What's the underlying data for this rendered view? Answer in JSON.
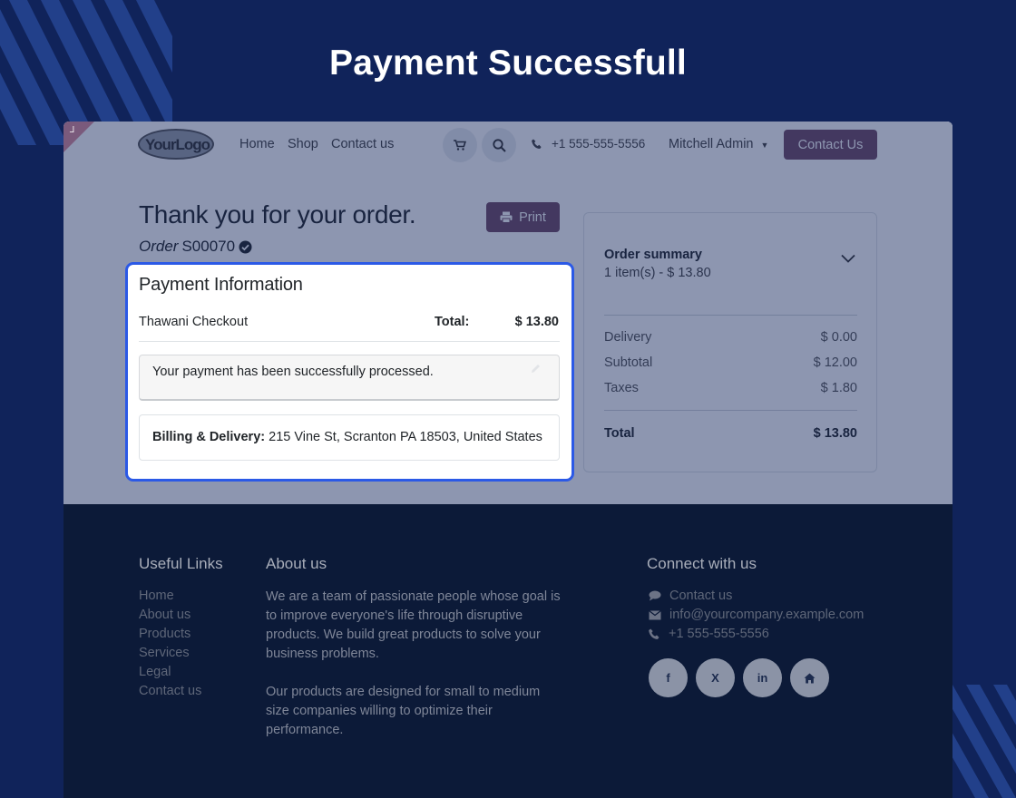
{
  "banner": {
    "title": "Payment Successfull"
  },
  "navbar": {
    "logo_text": "YourLogo",
    "links": [
      "Home",
      "Shop",
      "Contact us"
    ],
    "phone": "+1 555-555-5556",
    "user": "Mitchell Admin",
    "contact_button": "Contact Us"
  },
  "order": {
    "title": "Thank you for your order.",
    "order_label": "Order",
    "order_number": "S00070",
    "print_label": "Print"
  },
  "payment": {
    "title": "Payment Information",
    "method": "Thawani Checkout",
    "total_label": "Total:",
    "total_value": "$ 13.80",
    "message": "Your payment has been successfully processed.",
    "address_label": "Billing & Delivery:",
    "address": "215 Vine St, Scranton PA 18503, United States"
  },
  "summary": {
    "title": "Order summary",
    "items_line": "1 item(s) -  $ 13.80",
    "rows": [
      {
        "label": "Delivery",
        "value": "$ 0.00"
      },
      {
        "label": "Subtotal",
        "value": "$ 12.00"
      },
      {
        "label": "Taxes",
        "value": "$ 1.80"
      }
    ],
    "total_label": "Total",
    "total_value": "$ 13.80"
  },
  "footer": {
    "useful_links_title": "Useful Links",
    "useful_links": [
      "Home",
      "About us",
      "Products",
      "Services",
      "Legal",
      "Contact us"
    ],
    "about_title": "About us",
    "about_p1": "We are a team of passionate people whose goal is to improve everyone's life through disruptive products. We build great products to solve your business problems.",
    "about_p2": "Our products are designed for small to medium size companies willing to optimize their performance.",
    "connect_title": "Connect with us",
    "connect_items": [
      "Contact us",
      "info@yourcompany.example.com",
      "+1 555-555-5556"
    ],
    "social": [
      "f",
      "X",
      "in"
    ]
  },
  "colors": {
    "background": "#10235a",
    "accent": "#714b67",
    "highlight_border": "#2b59e6",
    "footer": "#0c1a38"
  }
}
